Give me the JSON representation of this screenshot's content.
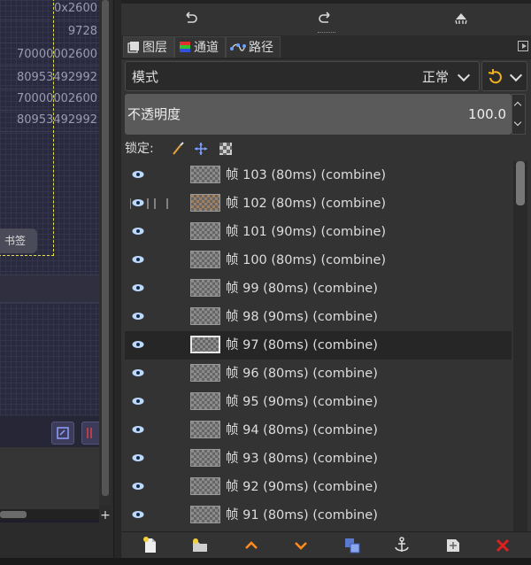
{
  "canvas": {
    "rows": [
      "0x2600",
      "9728",
      "70000002600",
      "80953492992",
      "70000002600",
      "80953492992"
    ],
    "bookmark_label": "书签"
  },
  "history": {
    "undo_icon": "undo-icon",
    "redo_icon": "redo-icon",
    "clear_icon": "clear-history-icon"
  },
  "tabs": [
    {
      "label": "图层",
      "icon": "layers-icon",
      "active": true
    },
    {
      "label": "通道",
      "icon": "channels-icon",
      "active": false
    },
    {
      "label": "路径",
      "icon": "paths-icon",
      "active": false
    }
  ],
  "mode": {
    "label": "模式",
    "value": "正常"
  },
  "opacity": {
    "label": "不透明度",
    "value": "100.0"
  },
  "lock": {
    "label": "锁定:",
    "icons": [
      "lock-pixels-icon",
      "lock-position-icon",
      "lock-alpha-icon"
    ]
  },
  "layers": [
    {
      "name": "帧 103 (80ms) (combine)",
      "selected": false
    },
    {
      "name": "帧 102 (80ms) (combine)",
      "selected": false
    },
    {
      "name": "帧 101 (90ms) (combine)",
      "selected": false
    },
    {
      "name": "帧 100 (80ms) (combine)",
      "selected": false
    },
    {
      "name": "帧 99 (80ms) (combine)",
      "selected": false
    },
    {
      "name": "帧 98 (90ms) (combine)",
      "selected": false
    },
    {
      "name": "帧 97 (80ms) (combine)",
      "selected": true
    },
    {
      "name": "帧 96 (80ms) (combine)",
      "selected": false
    },
    {
      "name": "帧 95 (90ms) (combine)",
      "selected": false
    },
    {
      "name": "帧 94 (80ms) (combine)",
      "selected": false
    },
    {
      "name": "帧 93 (80ms) (combine)",
      "selected": false
    },
    {
      "name": "帧 92 (90ms) (combine)",
      "selected": false
    },
    {
      "name": "帧 91 (80ms) (combine)",
      "selected": false
    }
  ],
  "colors": {
    "accent_orange": "#ff8a1e",
    "delete_red": "#e02020",
    "selection_yellow": "#e6e04a"
  }
}
